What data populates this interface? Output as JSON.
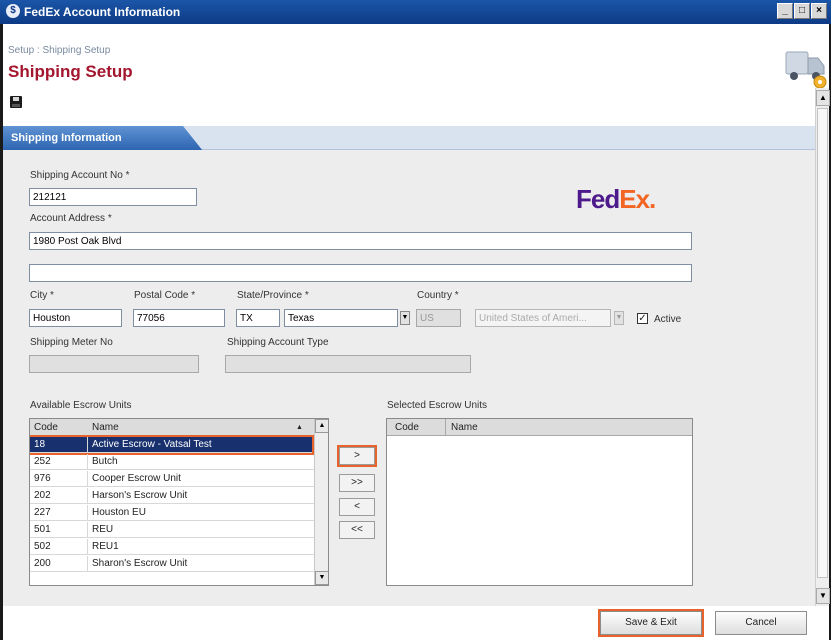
{
  "window": {
    "title": "FedEx Account Information",
    "controls": [
      "_",
      "□",
      "×"
    ]
  },
  "breadcrumb": "Setup : Shipping Setup",
  "page_title": "Shipping Setup",
  "tab_label": "Shipping Information",
  "brand": {
    "fed": "Fed",
    "ex": "Ex",
    "dot": ".",
    "colors": {
      "fed": "#4d1a8b",
      "ex": "#f26522"
    }
  },
  "form": {
    "shipping_account_no": {
      "label": "Shipping Account No *",
      "value": "212121"
    },
    "account_address": {
      "label": "Account Address *",
      "line1": "1980 Post Oak Blvd",
      "line2": ""
    },
    "city": {
      "label": "City *",
      "value": "Houston"
    },
    "postal_code": {
      "label": "Postal Code *",
      "value": "77056"
    },
    "state": {
      "label": "State/Province *",
      "code": "TX",
      "name": "Texas"
    },
    "country": {
      "label": "Country *",
      "code": "US",
      "name": "United States of Ameri..."
    },
    "active": {
      "label": "Active",
      "checked_glyph": "✓"
    },
    "shipping_meter_no": {
      "label": "Shipping Meter No",
      "value": ""
    },
    "shipping_account_type": {
      "label": "Shipping Account Type",
      "value": ""
    }
  },
  "available_units": {
    "label": "Available Escrow Units",
    "columns": [
      "Code",
      "Name"
    ],
    "rows": [
      {
        "code": "18",
        "name": "Active Escrow - Vatsal Test"
      },
      {
        "code": "252",
        "name": "Butch"
      },
      {
        "code": "976",
        "name": "Cooper Escrow Unit"
      },
      {
        "code": "202",
        "name": "Harson's Escrow Unit"
      },
      {
        "code": "227",
        "name": "Houston EU"
      },
      {
        "code": "501",
        "name": "REU"
      },
      {
        "code": "502",
        "name": "REU1"
      },
      {
        "code": "200",
        "name": "Sharon's Escrow Unit"
      }
    ]
  },
  "move_buttons": {
    "add": ">",
    "add_all": ">>",
    "remove": "<",
    "remove_all": "<<"
  },
  "selected_units": {
    "label": "Selected Escrow Units",
    "columns": [
      "Code",
      "Name"
    ]
  },
  "footer": {
    "save_exit": "Save & Exit",
    "cancel": "Cancel"
  },
  "accent_color": "#e8622b"
}
